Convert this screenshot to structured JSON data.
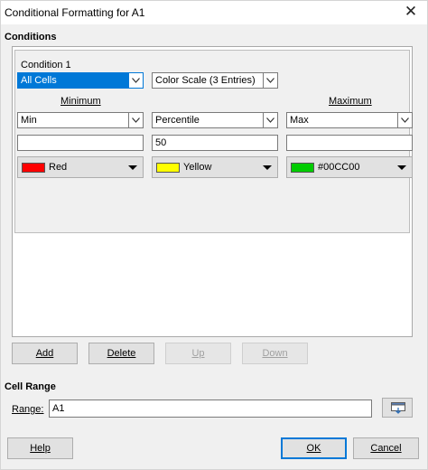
{
  "window": {
    "title": "Conditional Formatting for A1",
    "close_symbol": "✕"
  },
  "conditions": {
    "section_title": "Conditions",
    "condition_label": "Condition 1",
    "scope_select": "All Cells",
    "type_select": "Color Scale (3 Entries)",
    "minimum_label": "Minimum",
    "maximum_label": "Maximum",
    "min": {
      "type": "Min",
      "value": "",
      "color_name": "Red",
      "color": "#ff0000"
    },
    "mid": {
      "type": "Percentile",
      "value": "50",
      "color_name": "Yellow",
      "color": "#ffff00"
    },
    "max": {
      "type": "Max",
      "value": "",
      "color_name": "#00CC00",
      "color": "#00cc00"
    }
  },
  "actions": {
    "add": "Add",
    "delete": "Delete",
    "up": "Up",
    "down": "Down"
  },
  "cell_range": {
    "section_title": "Cell Range",
    "range_label": "Range:",
    "range_value": "A1"
  },
  "footer": {
    "help": "Help",
    "ok": "OK",
    "cancel": "Cancel"
  }
}
